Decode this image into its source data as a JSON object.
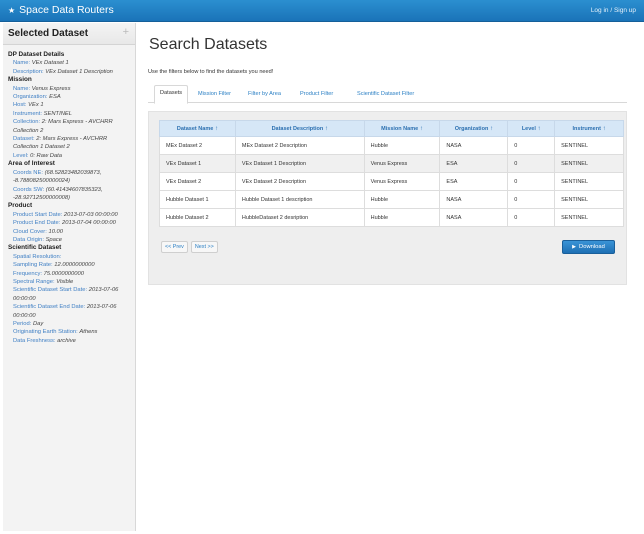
{
  "navbar": {
    "brand": "Space Data Routers",
    "login": "Log in / Sign up"
  },
  "sidebar": {
    "title": "Selected Dataset",
    "sections": [
      {
        "title": "DP Dataset Details",
        "rows": [
          {
            "k": "Name:",
            "v": "VEx Dataset 1"
          },
          {
            "k": "Description:",
            "v": "VEx Dataset 1 Description"
          }
        ]
      },
      {
        "title": "Mission",
        "rows": [
          {
            "k": "Name:",
            "v": "Venus Express"
          },
          {
            "k": "Organization:",
            "v": "ESA"
          },
          {
            "k": "Host:",
            "v": "VEx 1"
          },
          {
            "k": "Instrument:",
            "v": "SENTINEL"
          },
          {
            "k": "Collection:",
            "v": "2: Mars Express - AVCHRR Collection 2"
          },
          {
            "k": "Dataset:",
            "v": "2: Mars Express - AVCHRR Collection 1 Dataset 2"
          },
          {
            "k": "Level:",
            "v": "0: Raw Data"
          }
        ]
      },
      {
        "title": "Area of Interest",
        "rows": [
          {
            "k": "Coords NE:",
            "v": "(68.52823482039873, -8.788082500000024)"
          },
          {
            "k": "Coords SW:",
            "v": "(60.41434607835323, -28.92712500000008)"
          }
        ]
      },
      {
        "title": "Product",
        "rows": [
          {
            "k": "Product Start Date:",
            "v": "2013-07-03 00:00:00"
          },
          {
            "k": "Product End Date:",
            "v": "2013-07-04 00:00:00"
          },
          {
            "k": "Cloud Cover:",
            "v": "10.00"
          },
          {
            "k": "Data Origin:",
            "v": "Space"
          }
        ]
      },
      {
        "title": "Scientific Dataset",
        "rows": [
          {
            "k": "Spatial Resolution:",
            "v": ""
          },
          {
            "k": "Sampling Rate:",
            "v": "12.0000000000"
          },
          {
            "k": "Frequency:",
            "v": "75.0000000000"
          },
          {
            "k": "Spectral Range:",
            "v": "Visible"
          },
          {
            "k": "Scientific Dataset Start Date:",
            "v": "2013-07-06 00:00:00"
          },
          {
            "k": "Scientific Dataset End Date:",
            "v": "2013-07-06 00:00:00"
          },
          {
            "k": "Period:",
            "v": "Day"
          },
          {
            "k": "Originating Earth Station:",
            "v": "Athens"
          },
          {
            "k": "Data Freshness:",
            "v": "archive"
          }
        ]
      }
    ]
  },
  "main": {
    "title": "Search Datasets",
    "intro": "Use the filters below to find the datasets you need!",
    "tabs": [
      "Datasets",
      "Mission Filter",
      "Filter by Area",
      "Product Filter",
      "Scientific Dataset Filter"
    ],
    "columns": [
      "Dataset Name",
      "Dataset Description",
      "Mission Name",
      "Organization",
      "Level",
      "Instrument"
    ],
    "rows": [
      [
        "MEx Dataset 2",
        "MEx Dataset 2 Description",
        "Hubble",
        "NASA",
        "0",
        "SENTINEL"
      ],
      [
        "VEx Dataset 1",
        "VEx Dataset 1 Description",
        "Venus Express",
        "ESA",
        "0",
        "SENTINEL"
      ],
      [
        "VEx Dataset 2",
        "VEx Dataset 2 Description",
        "Venus Express",
        "ESA",
        "0",
        "SENTINEL"
      ],
      [
        "Hubble Dataset 1",
        "Hubble Dataset 1 description",
        "Hubble",
        "NASA",
        "0",
        "SENTINEL"
      ],
      [
        "Hubble Dataset 2",
        "HubbleDataset 2 desription",
        "Hubble",
        "NASA",
        "0",
        "SENTINEL"
      ]
    ],
    "selected_row": 1,
    "prev": "<< Prev",
    "next": "Next >>",
    "download": "Download"
  },
  "icons": {
    "brand": "star-icon",
    "download": "play-arrow-icon",
    "sort": "sort-arrow-icon",
    "collapse": "plus-icon"
  }
}
